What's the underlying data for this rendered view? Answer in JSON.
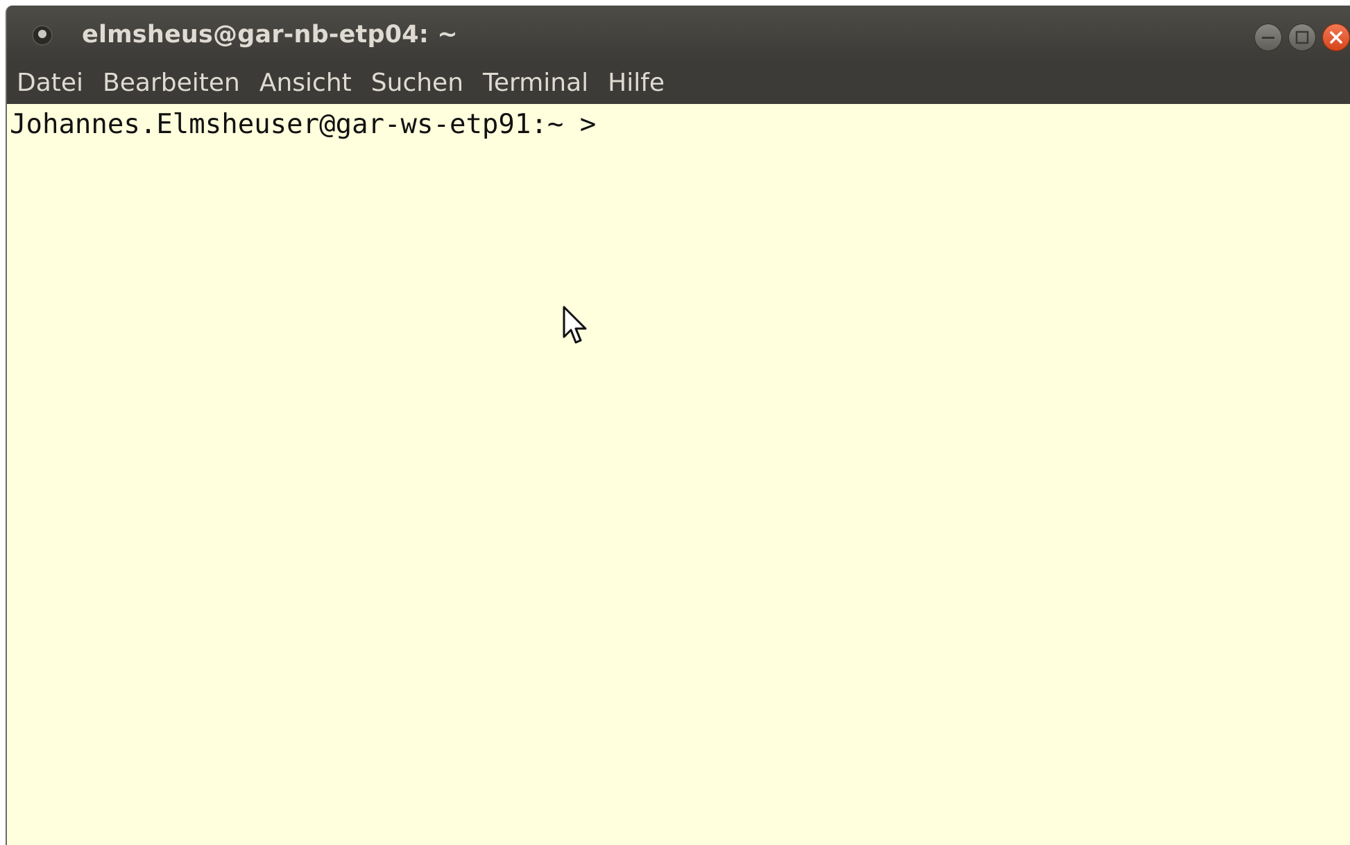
{
  "window": {
    "title": "elmsheus@gar-nb-etp04: ~",
    "icon": "terminal-app-icon",
    "buttons": [
      "minimize-icon",
      "maximize-icon",
      "close-icon"
    ]
  },
  "menubar": {
    "items": [
      "Datei",
      "Bearbeiten",
      "Ansicht",
      "Suchen",
      "Terminal",
      "Hilfe"
    ]
  },
  "terminal": {
    "prompt": "Johannes.Elmsheuser@gar-ws-etp91:~ >",
    "background": "#ffffdd",
    "text_color": "#111111"
  },
  "colors": {
    "titlebar": "#3c3b37",
    "menu_text": "#dfdbd2",
    "close_button": "#e2592b"
  }
}
